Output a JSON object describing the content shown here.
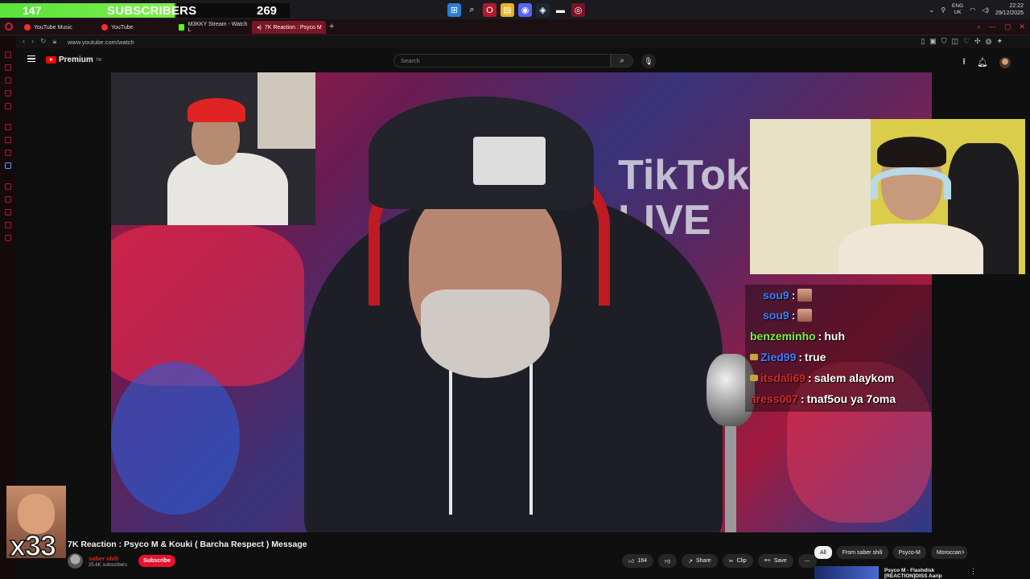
{
  "overlay": {
    "sub_count": "147",
    "sub_label": "SUBSCRIBERS",
    "sub_goal": "269",
    "multiplier": "x33"
  },
  "taskbar": {
    "lang_line1": "ENG",
    "lang_line2": "UK",
    "time": "22:22",
    "date": "29/12/2025"
  },
  "tabs": [
    {
      "label": "YouTube Music"
    },
    {
      "label": "YouTube"
    },
    {
      "label": "M3KKY Stream - Watch L"
    },
    {
      "label": "7K Reaction : Psyco M"
    }
  ],
  "address": {
    "url": "www.youtube.com/watch"
  },
  "masthead": {
    "logo_text": "Premium",
    "logo_sup": "TM",
    "search_placeholder": "Search"
  },
  "video": {
    "tiktok_line1": "TikTok",
    "tiktok_line2": "LIVE"
  },
  "chat": [
    {
      "user": "sou9",
      "color": "#3d7eff",
      "message": "",
      "emote": true,
      "badge": false
    },
    {
      "user": "sou9",
      "color": "#3d7eff",
      "message": "",
      "emote": true,
      "badge": false
    },
    {
      "user": "benzeminho",
      "color": "#7cf04b",
      "message": "huh",
      "emote": false,
      "badge": false
    },
    {
      "user": "Zied99",
      "color": "#3d7eff",
      "message": "true",
      "emote": false,
      "badge": true
    },
    {
      "user": "itsdali69",
      "color": "#d02a2a",
      "message": "salem alaykom",
      "emote": false,
      "badge": true
    },
    {
      "user": "aress007",
      "color": "#d02a2a",
      "message": "tnaf5ou ya 7oma",
      "emote": false,
      "badge": false
    }
  ],
  "info": {
    "title": "7K Reaction : Psyco M & Kouki ( Barcha Respect ) Message",
    "channel": "saber shili",
    "subscribers": "25.6K subscribers",
    "subscribe_label": "Subscribe",
    "likes": "164",
    "share": "Share",
    "clip": "Clip",
    "save": "Save"
  },
  "chips": [
    "All",
    "From saber shili",
    "Psyco-M",
    "Moroccan"
  ],
  "recommendation": {
    "title_line1": "Psyco M - Flashdisk",
    "title_line2": "[REACTION]DISS Aarip"
  },
  "colors": {
    "accent_red": "#e8112d",
    "progress_green": "#7cf04b",
    "chat_blue": "#3d7eff"
  }
}
